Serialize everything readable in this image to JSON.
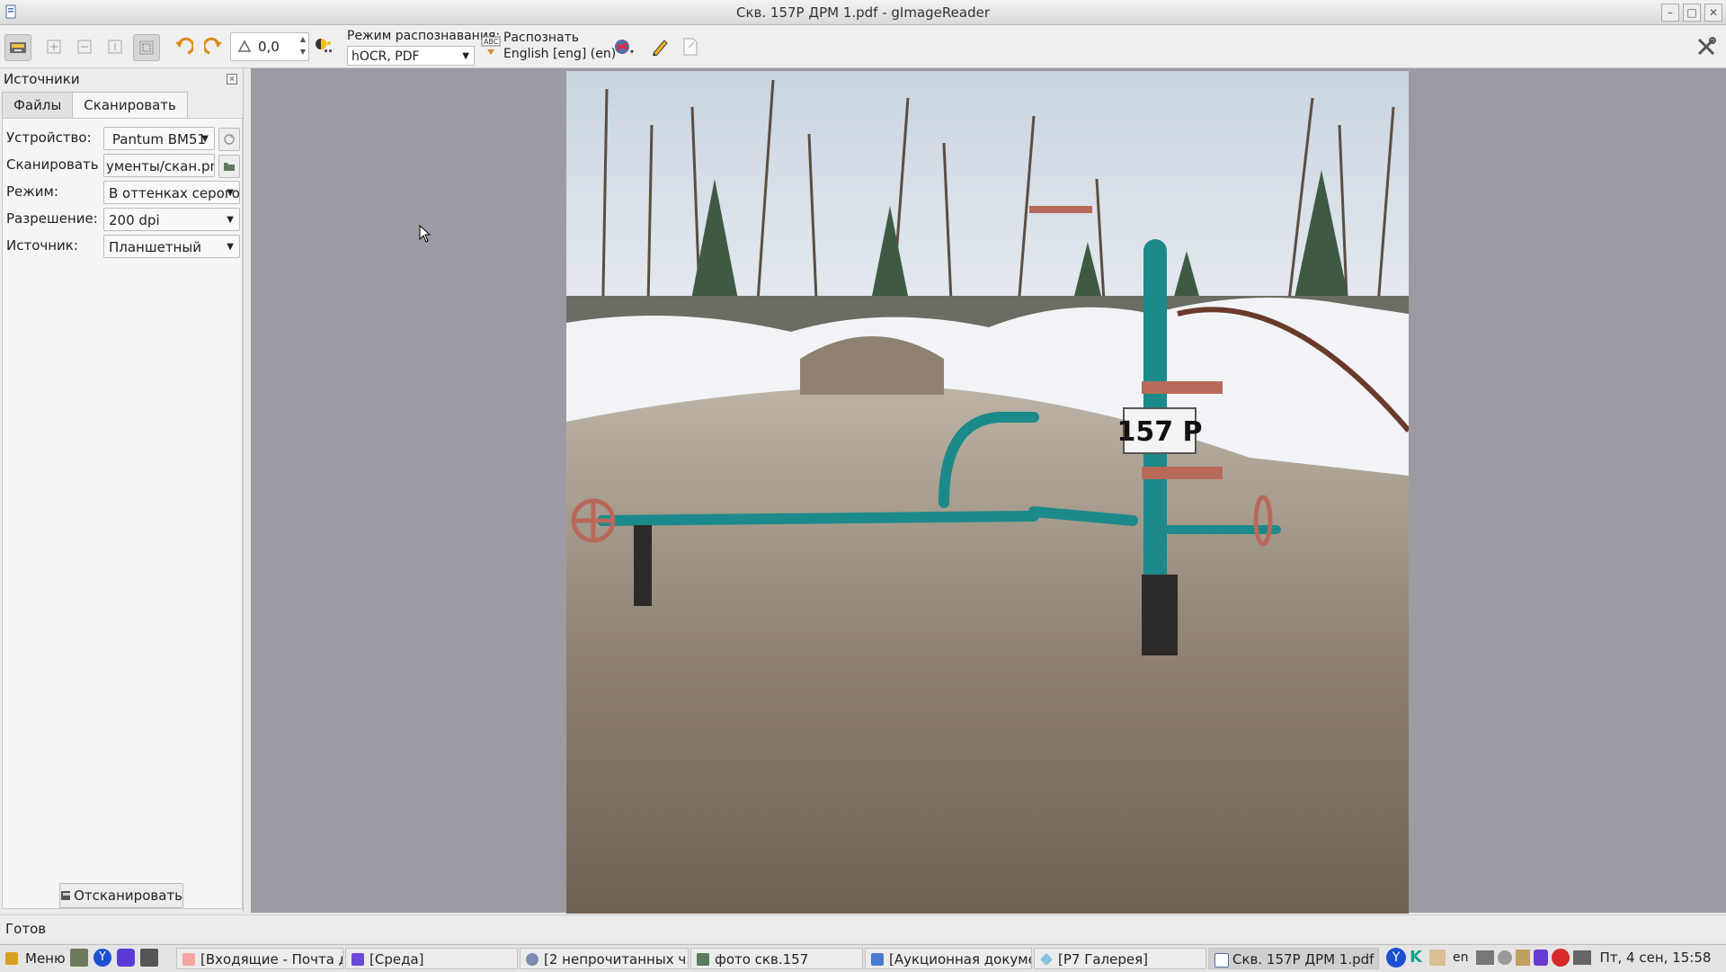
{
  "window": {
    "title": "Скв. 157Р ДРМ 1.pdf - gImageReader"
  },
  "toolbar": {
    "rotation_value": "0,0",
    "mode_label": "Режим распознавания:",
    "mode_value": "hOCR, PDF",
    "recognize_label": "Распознать",
    "language_label": "English [eng] (en)"
  },
  "sources": {
    "title": "Источники",
    "tabs": [
      "Файлы",
      "Сканировать"
    ],
    "device_label": "Устройство:",
    "device_value": "Pantum BM51",
    "scan_to_label": "Сканировать в:",
    "scan_to_value": "ументы/скан.png",
    "mode_label": "Режим:",
    "mode_value": "В оттенках серого",
    "resolution_label": "Разрешение:",
    "resolution_value": "200 dpi",
    "source_label": "Источник:",
    "source_value": "Планшетный",
    "scan_button": "Отсканировать"
  },
  "image": {
    "sign_text": "157 P"
  },
  "status": {
    "text": "Готов"
  },
  "taskbar": {
    "menu": "Меню",
    "tasks": [
      "[Входящие - Почта д...",
      "[Среда]",
      "[2 непрочитанных ч...",
      "фото скв.157",
      "[Аукционная докуме...",
      "[Р7 Галерея]",
      "Скв. 157Р ДРМ 1.pdf ..."
    ],
    "lang": "en",
    "clock": "Пт, 4 сен, 15:58"
  },
  "colors": {
    "canvas_bg": "#9c9ba3",
    "pipe": "#1c8a8a",
    "valve": "#b86a5a"
  }
}
